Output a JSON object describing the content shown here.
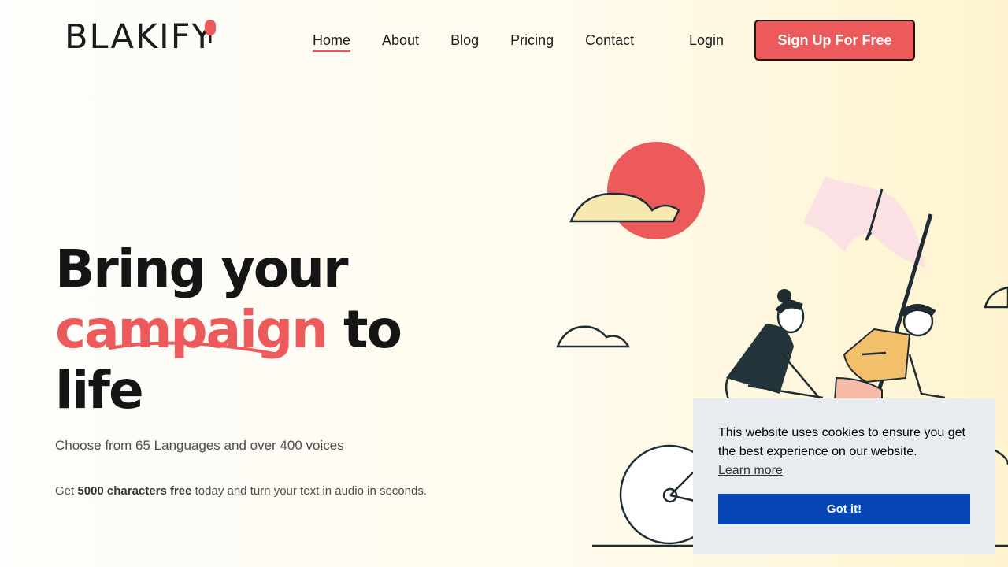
{
  "brand": {
    "name": "BLAKIFY",
    "accent": "#ec5a5b"
  },
  "nav": {
    "items": [
      {
        "label": "Home",
        "active": true
      },
      {
        "label": "About"
      },
      {
        "label": "Blog"
      },
      {
        "label": "Pricing"
      },
      {
        "label": "Contact"
      }
    ],
    "login": "Login",
    "signup": "Sign Up For Free"
  },
  "hero": {
    "line1": "Bring your",
    "highlight": "campaign",
    "line2_rest": " to",
    "line3": "life",
    "subtitle": "Choose from 65 Languages and over 400 voices",
    "note_prefix": "Get ",
    "note_bold": "5000 characters free",
    "note_suffix": " today and turn your text in audio in seconds."
  },
  "cookie": {
    "message": "This website uses cookies to ensure you get the best experience on our website.",
    "learn_more": "Learn more",
    "accept": "Got it!",
    "button_color": "#0746b6"
  }
}
